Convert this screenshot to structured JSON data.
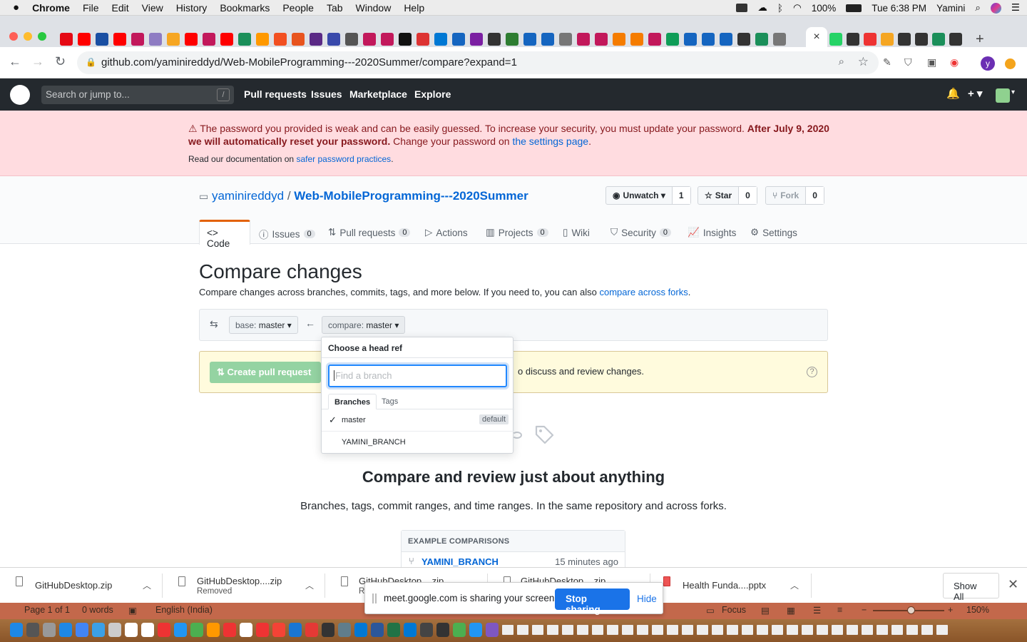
{
  "menubar": {
    "apple": "",
    "app": "Chrome",
    "items": [
      "File",
      "Edit",
      "View",
      "History",
      "Bookmarks",
      "People",
      "Tab",
      "Window",
      "Help"
    ],
    "battery": "100%",
    "clock": "Tue 6:38 PM",
    "user": "Yamini"
  },
  "browser": {
    "active_tab_close": "×",
    "new_tab": "+",
    "url": "github.com/yaminireddyd/Web-MobileProgramming---2020Summer/compare?expand=1",
    "profile_initial": "y"
  },
  "github": {
    "search_placeholder": "Search or jump to...",
    "search_shortcut": "/",
    "nav": [
      "Pull requests",
      "Issues",
      "Marketplace",
      "Explore"
    ],
    "plus": "+ ▾"
  },
  "flash": {
    "warn_text": "The password you provided is weak and can be easily guessed. To increase your security, you must update your password.",
    "warn_bold": "After July 9, 2020 we will automatically reset your password.",
    "warn_tail": "Change your password on",
    "settings_link": "the settings page",
    "period": ".",
    "doc_text": "Read our documentation on",
    "doc_link": "safer password practices",
    "doc_period": "."
  },
  "repo": {
    "owner": "yaminireddyd",
    "sep": "/",
    "name": "Web-MobileProgramming---2020Summer",
    "watch_label": "Unwatch ▾",
    "watch_count": "1",
    "star_label": "Star",
    "star_count": "0",
    "fork_label": "Fork",
    "fork_count": "0",
    "tabs": [
      {
        "label": "Code"
      },
      {
        "label": "Issues",
        "count": "0"
      },
      {
        "label": "Pull requests",
        "count": "0"
      },
      {
        "label": "Actions"
      },
      {
        "label": "Projects",
        "count": "0"
      },
      {
        "label": "Wiki"
      },
      {
        "label": "Security",
        "count": "0"
      },
      {
        "label": "Insights"
      },
      {
        "label": "Settings"
      }
    ]
  },
  "compare": {
    "title": "Compare changes",
    "desc": "Compare changes across branches, commits, tags, and more below. If you need to, you can also",
    "desc_link": "compare across forks",
    "desc_period": ".",
    "base_prefix": "base:",
    "base_value": "master ▾",
    "arrow": "←",
    "compare_prefix": "compare:",
    "compare_value": "master ▾",
    "pr_button": "Create pull request",
    "discuss_text": "o discuss and review changes.",
    "help": "?"
  },
  "dropdown": {
    "header": "Choose a head ref",
    "input_placeholder": "Find a branch",
    "tab_branches": "Branches",
    "tab_tags": "Tags",
    "check": "✓",
    "branches": [
      "master",
      "YAMINI_BRANCH"
    ],
    "default_badge": "default"
  },
  "blankslate": {
    "heading": "Compare and review just about anything",
    "sub": "Branches, tags, commit ranges, and time ranges. In the same repository and across forks.",
    "examples_header": "EXAMPLE COMPARISONS",
    "example_branch": "YAMINI_BRANCH",
    "example_time": "15 minutes ago"
  },
  "downloads": {
    "items": [
      {
        "name": "GitHubDesktop.zip",
        "status": ""
      },
      {
        "name": "GitHubDesktop....zip",
        "status": "Removed"
      },
      {
        "name": "GitHubDesktop....zip",
        "status": "R"
      },
      {
        "name": "GitHubDesktop....zip",
        "status": ""
      },
      {
        "name": "Health Funda....pptx",
        "status": ""
      }
    ],
    "show_all": "Show All",
    "close": "✕"
  },
  "sharing": {
    "message": "meet.google.com is sharing your screen.",
    "stop": "Stop sharing",
    "hide": "Hide"
  },
  "wordstatus": {
    "page": "Page 1 of 1",
    "words": "0 words",
    "language": "English (India)",
    "focus": "Focus",
    "zoom": "150%",
    "minus": "−",
    "plus": "+"
  }
}
